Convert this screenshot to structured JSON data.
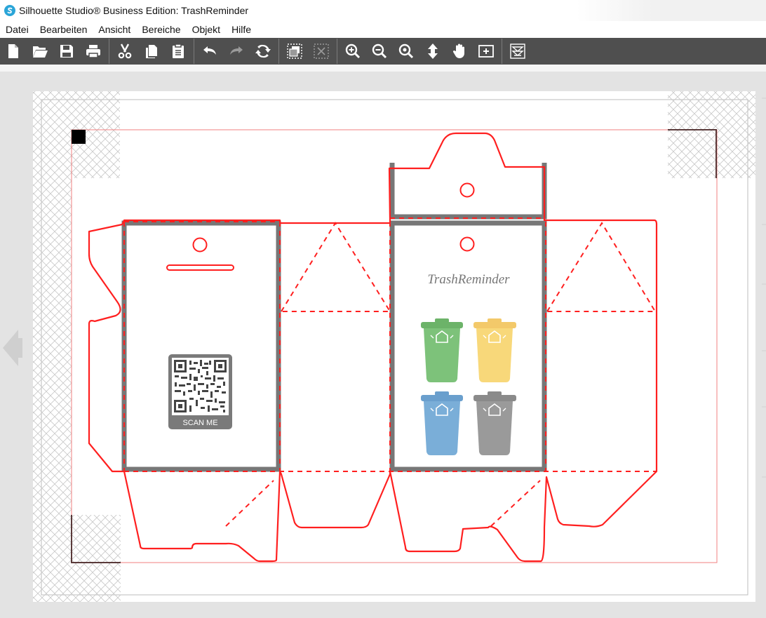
{
  "window": {
    "title": "Silhouette Studio® Business Edition: TrashReminder",
    "logo": "silhouette-s-logo"
  },
  "menu": [
    "Datei",
    "Bearbeiten",
    "Ansicht",
    "Bereiche",
    "Objekt",
    "Hilfe"
  ],
  "toolbar": {
    "groups": [
      [
        "new-file-icon",
        "open-folder-icon",
        "save-icon",
        "print-icon"
      ],
      [
        "cut-icon",
        "copy-icon",
        "paste-icon"
      ],
      [
        "undo-icon",
        "redo-icon",
        "refresh-icon"
      ],
      [
        "group-icon",
        "ungroup-icon"
      ],
      [
        "zoom-in-icon",
        "zoom-out-icon",
        "zoom-fit-icon",
        "pan-vertical-icon",
        "hand-icon",
        "fit-page-icon"
      ],
      [
        "trace-icon"
      ]
    ]
  },
  "design": {
    "brand_text": "TrashReminder",
    "qr_label": "SCAN ME",
    "bin_colors": [
      "#7dc27a",
      "#f8d87a",
      "#7aaed8",
      "#9a9a9a"
    ],
    "cut_color": "#ff1f1f",
    "fold_frame_color": "#777777"
  },
  "colors": {
    "toolbar_bg": "#4f4f4f",
    "workspace_bg": "#e3e3e3",
    "page_bg": "#ffffff"
  }
}
